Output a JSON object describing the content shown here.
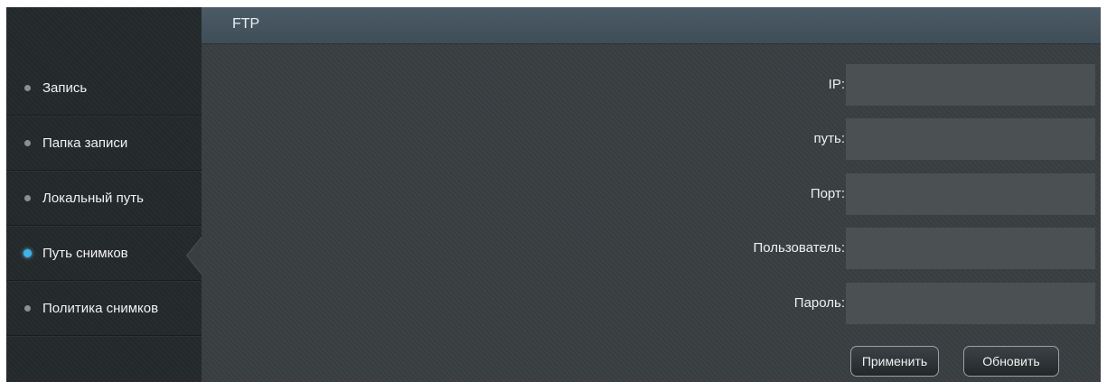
{
  "header": {
    "title": "FTP"
  },
  "sidebar": {
    "items": [
      {
        "label": "Запись",
        "active": false
      },
      {
        "label": "Папка записи",
        "active": false
      },
      {
        "label": "Локальный путь",
        "active": false
      },
      {
        "label": "Путь снимков",
        "active": true
      },
      {
        "label": "Политика снимков",
        "active": false
      }
    ]
  },
  "form": {
    "fields": [
      {
        "label": "IP:",
        "value": ""
      },
      {
        "label": "путь:",
        "value": ""
      },
      {
        "label": "Порт:",
        "value": ""
      },
      {
        "label": "Пользователь:",
        "value": ""
      },
      {
        "label": "Пароль:",
        "value": ""
      }
    ],
    "apply_label": "Применить",
    "refresh_label": "Обновить"
  },
  "colors": {
    "accent": "#3fb3ea",
    "header": "#45545e",
    "sidebar": "#24292c",
    "content": "#393e41",
    "input": "#4b5053"
  },
  "icons": {
    "bullet": "bullet-dot-icon",
    "active_bullet": "active-bullet-dot-icon"
  }
}
